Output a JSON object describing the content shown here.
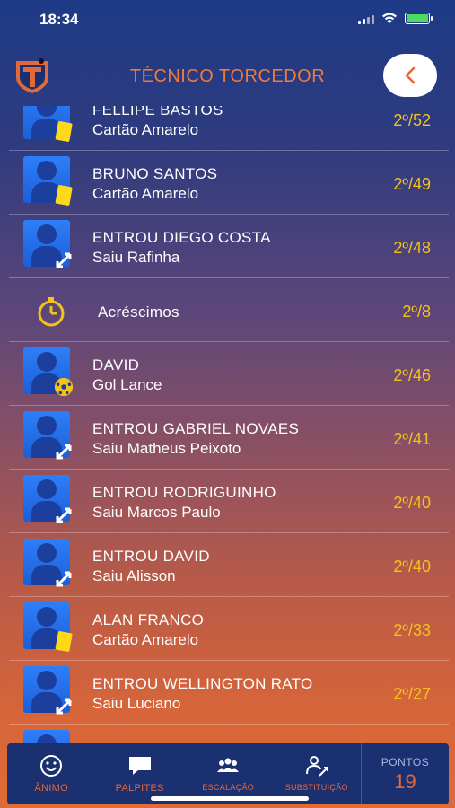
{
  "status": {
    "time": "18:34"
  },
  "header": {
    "title": "TÉCNICO TORCEDOR",
    "back_icon": "chevron-left-icon",
    "accent": "#f07a3a"
  },
  "events": [
    {
      "type": "card",
      "title": "FELLIPE BASTOS",
      "sub": "Cartão Amarelo",
      "time": "2º/52"
    },
    {
      "type": "card",
      "title": "BRUNO SANTOS",
      "sub": "Cartão Amarelo",
      "time": "2º/49"
    },
    {
      "type": "sub",
      "title": "ENTROU DIEGO COSTA",
      "sub": "Saiu Rafinha",
      "time": "2º/48"
    },
    {
      "type": "extra",
      "title": "Acréscimos",
      "sub": "",
      "time": "2º/8"
    },
    {
      "type": "goal",
      "title": "DAVID",
      "sub": "Gol Lance",
      "time": "2º/46"
    },
    {
      "type": "sub",
      "title": "ENTROU GABRIEL NOVAES",
      "sub": "Saiu Matheus Peixoto",
      "time": "2º/41"
    },
    {
      "type": "sub",
      "title": "ENTROU RODRIGUINHO",
      "sub": "Saiu Marcos Paulo",
      "time": "2º/40"
    },
    {
      "type": "sub",
      "title": "ENTROU DAVID",
      "sub": "Saiu Alisson",
      "time": "2º/40"
    },
    {
      "type": "card",
      "title": "ALAN FRANCO",
      "sub": "Cartão Amarelo",
      "time": "2º/33"
    },
    {
      "type": "sub",
      "title": "ENTROU WELLINGTON RATO",
      "sub": "Saiu Luciano",
      "time": "2º/27"
    }
  ],
  "tabs": [
    {
      "label": "ÂNIMO",
      "icon": "smile-icon"
    },
    {
      "label": "PALPITES",
      "icon": "chat-icon"
    },
    {
      "label": "ESCALAÇÃO",
      "icon": "team-icon"
    },
    {
      "label": "SUBSTITUIÇÃO",
      "icon": "substitution-icon"
    }
  ],
  "pontos": {
    "label": "PONTOS",
    "value": "19"
  },
  "colors": {
    "time": "#f5c21b",
    "tab_label": "#e4693a",
    "tabbar_bg": "#1b3070"
  }
}
